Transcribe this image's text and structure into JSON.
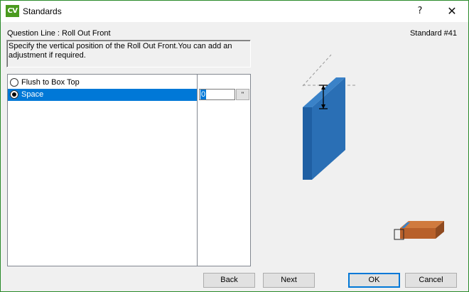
{
  "window": {
    "icon_text": "CV",
    "title": "Standards",
    "help_label": "?",
    "close_label": "✕"
  },
  "header": {
    "question_line": "Question Line : Roll Out Front",
    "standard_number": "Standard #41"
  },
  "description": "Specify the vertical position of the Roll Out Front.You can add an adjustment if required.",
  "options": [
    {
      "label": "Flush to Box Top",
      "selected": false
    },
    {
      "label": "Space",
      "selected": true
    }
  ],
  "value_input": {
    "value": "0",
    "unit_button": "\""
  },
  "buttons": {
    "back": "Back",
    "next": "Next",
    "ok": "OK",
    "cancel": "Cancel"
  },
  "colors": {
    "selection": "#0078d7",
    "panel_blue": "#2a6fb5",
    "thumb_brown": "#b8602a",
    "app_icon_green": "#4a9a1e"
  }
}
